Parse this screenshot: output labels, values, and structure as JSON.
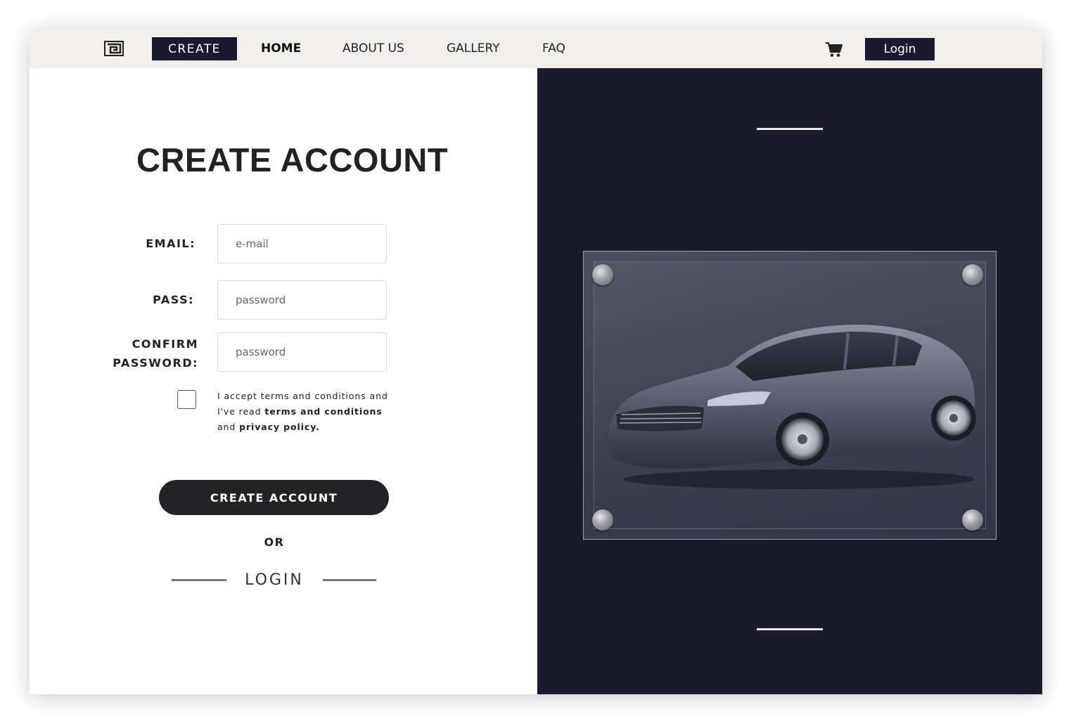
{
  "nav": {
    "logo_icon": "maze-logo-icon",
    "create_label": "CREATE",
    "links": [
      "HOME",
      "ABOUT US",
      "GALLERY",
      "FAQ"
    ],
    "active_link": "HOME",
    "cart_icon": "cart-icon",
    "login_label": "Login"
  },
  "form": {
    "title": "CREATE ACCOUNT",
    "email_label": "EMAIL:",
    "email_placeholder": "e-mail",
    "pass_label": "PASS:",
    "pass_placeholder": "password",
    "confirm_label_line1": "CONFIRM",
    "confirm_label_line2": "PASSWORD:",
    "confirm_placeholder": "password",
    "terms_part1": "I accept terms and conditions and I've read ",
    "terms_bold1": "terms and conditions",
    "terms_part2": " and ",
    "terms_bold2": "privacy policy.",
    "submit_label": "CREATE ACCOUNT",
    "or_label": "OR",
    "login_label": "LOGIN"
  },
  "hero": {
    "image": "car-photo",
    "background": "#1a1a2c"
  },
  "colors": {
    "nav_bg": "#f0efec",
    "accent_dark": "#1b1a2e",
    "button": "#232325"
  }
}
